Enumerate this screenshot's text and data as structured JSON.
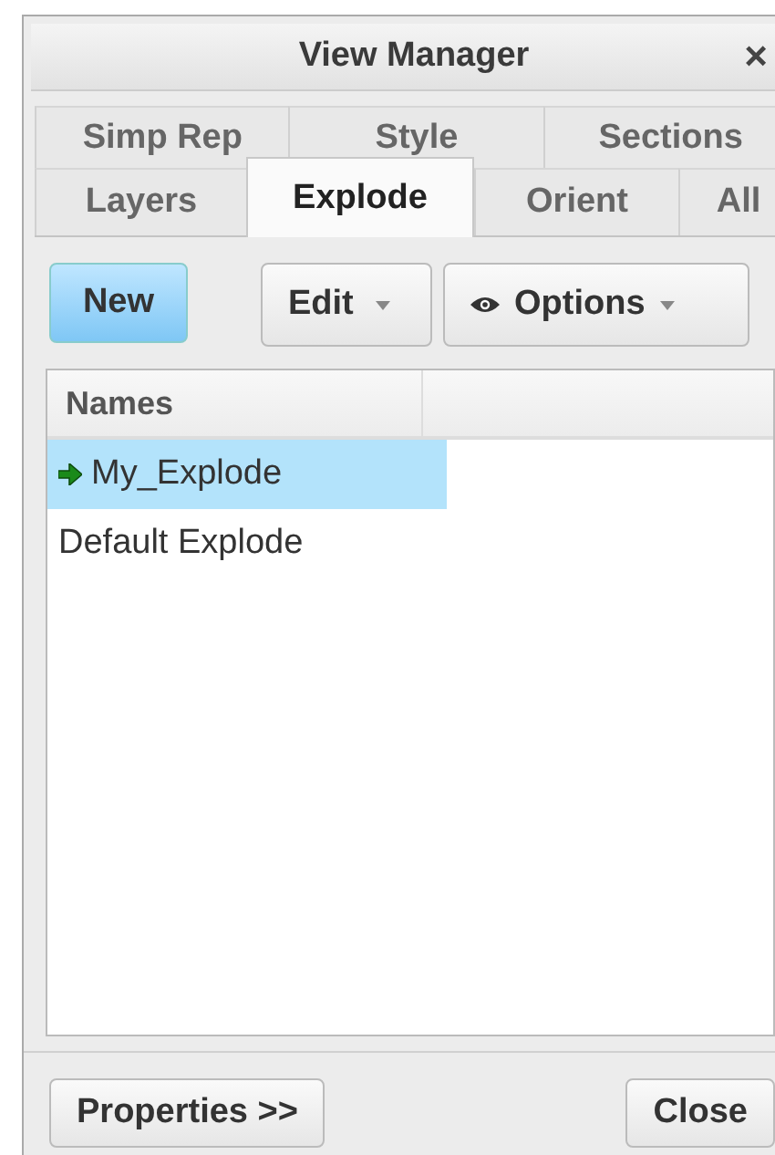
{
  "window": {
    "title": "View Manager",
    "close": "×"
  },
  "tab_rows": [
    [
      {
        "label": "Simp Rep",
        "selected": false
      },
      {
        "label": "Style",
        "selected": false
      },
      {
        "label": "Sections",
        "selected": false
      }
    ],
    [
      {
        "label": "Layers",
        "selected": false
      },
      {
        "label": "Explode",
        "selected": true
      },
      {
        "label": "Orient",
        "selected": false
      },
      {
        "label": "All",
        "selected": false
      }
    ]
  ],
  "toolbar": [
    {
      "label": "New",
      "kind": "primary"
    },
    {
      "label": "Edit",
      "kind": "dropdown"
    },
    {
      "label": "Options",
      "kind": "viewdropdown"
    }
  ],
  "table": {
    "columns": [
      "Names"
    ],
    "rows": [
      {
        "name": "My_Explode",
        "selected": true,
        "active": true
      },
      {
        "name": "Default Explode",
        "selected": false,
        "active": false
      }
    ]
  },
  "footer": {
    "buttons": [
      "Properties >>",
      "Close"
    ]
  }
}
